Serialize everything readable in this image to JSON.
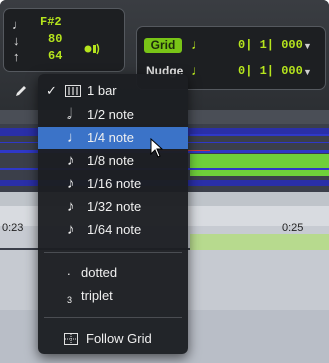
{
  "mini_panel": {
    "note_name": "F#2",
    "velocity": "80",
    "value_3": "64"
  },
  "grid": {
    "label": "Grid",
    "value": "0| 1| 000",
    "note_icon": "quarter-note-icon"
  },
  "nudge": {
    "label": "Nudge",
    "value": "0| 1| 000",
    "note_icon": "quarter-note-icon"
  },
  "ruler": {
    "start": "0:23",
    "end": "0:25"
  },
  "menu": {
    "bar_item": "1 bar",
    "note_items": [
      "1/2 note",
      "1/4 note",
      "1/8 note",
      "1/16 note",
      "1/32 note",
      "1/64 note"
    ],
    "selected_index": 1,
    "dotted": "dotted",
    "triplet": "triplet",
    "triplet_symbol": "3",
    "follow_grid": "Follow Grid"
  },
  "colors": {
    "accent_green": "#79c417",
    "readout_green": "#b6e51d",
    "selection_blue": "#3b73c8",
    "track_blue": "#2f38c8",
    "track_green": "#6fd03a"
  }
}
